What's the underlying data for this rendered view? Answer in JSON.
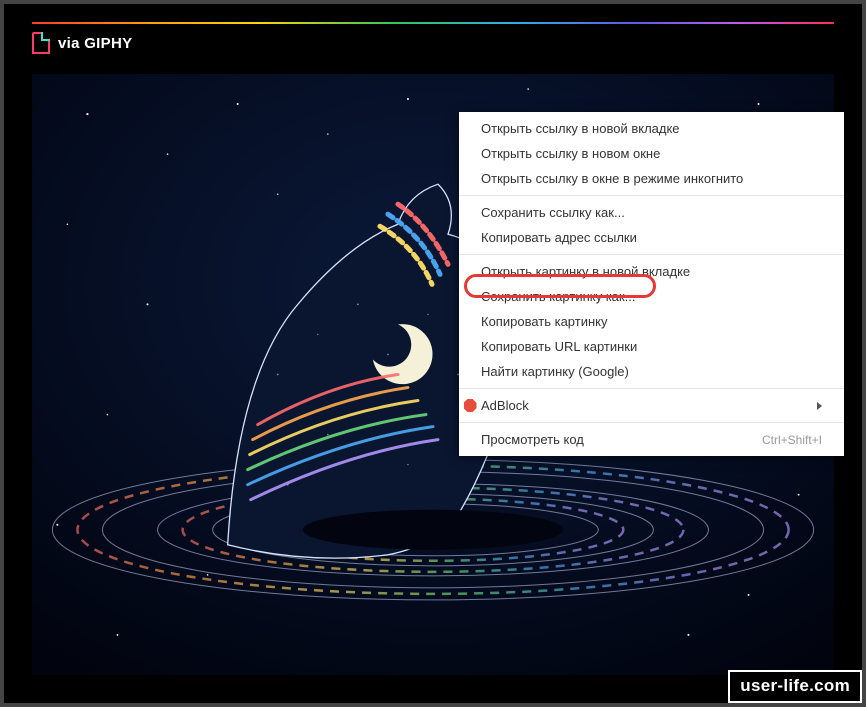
{
  "header": {
    "via_label": "via GIPHY"
  },
  "context_menu": {
    "groups": [
      [
        "Открыть ссылку в новой вкладке",
        "Открыть ссылку в новом окне",
        "Открыть ссылку в окне в режиме инкогнито"
      ],
      [
        "Сохранить ссылку как...",
        "Копировать адрес ссылки"
      ],
      [
        "Открыть картинку в новой вкладке",
        "Сохранить картинку как...",
        "Копировать картинку",
        "Копировать URL картинки",
        "Найти картинку (Google)"
      ]
    ],
    "adblock_label": "AdBlock",
    "inspect_label": "Просмотреть код",
    "inspect_shortcut": "Ctrl+Shift+I",
    "highlighted": "Сохранить картинку как..."
  },
  "watermark": "user-life.com"
}
